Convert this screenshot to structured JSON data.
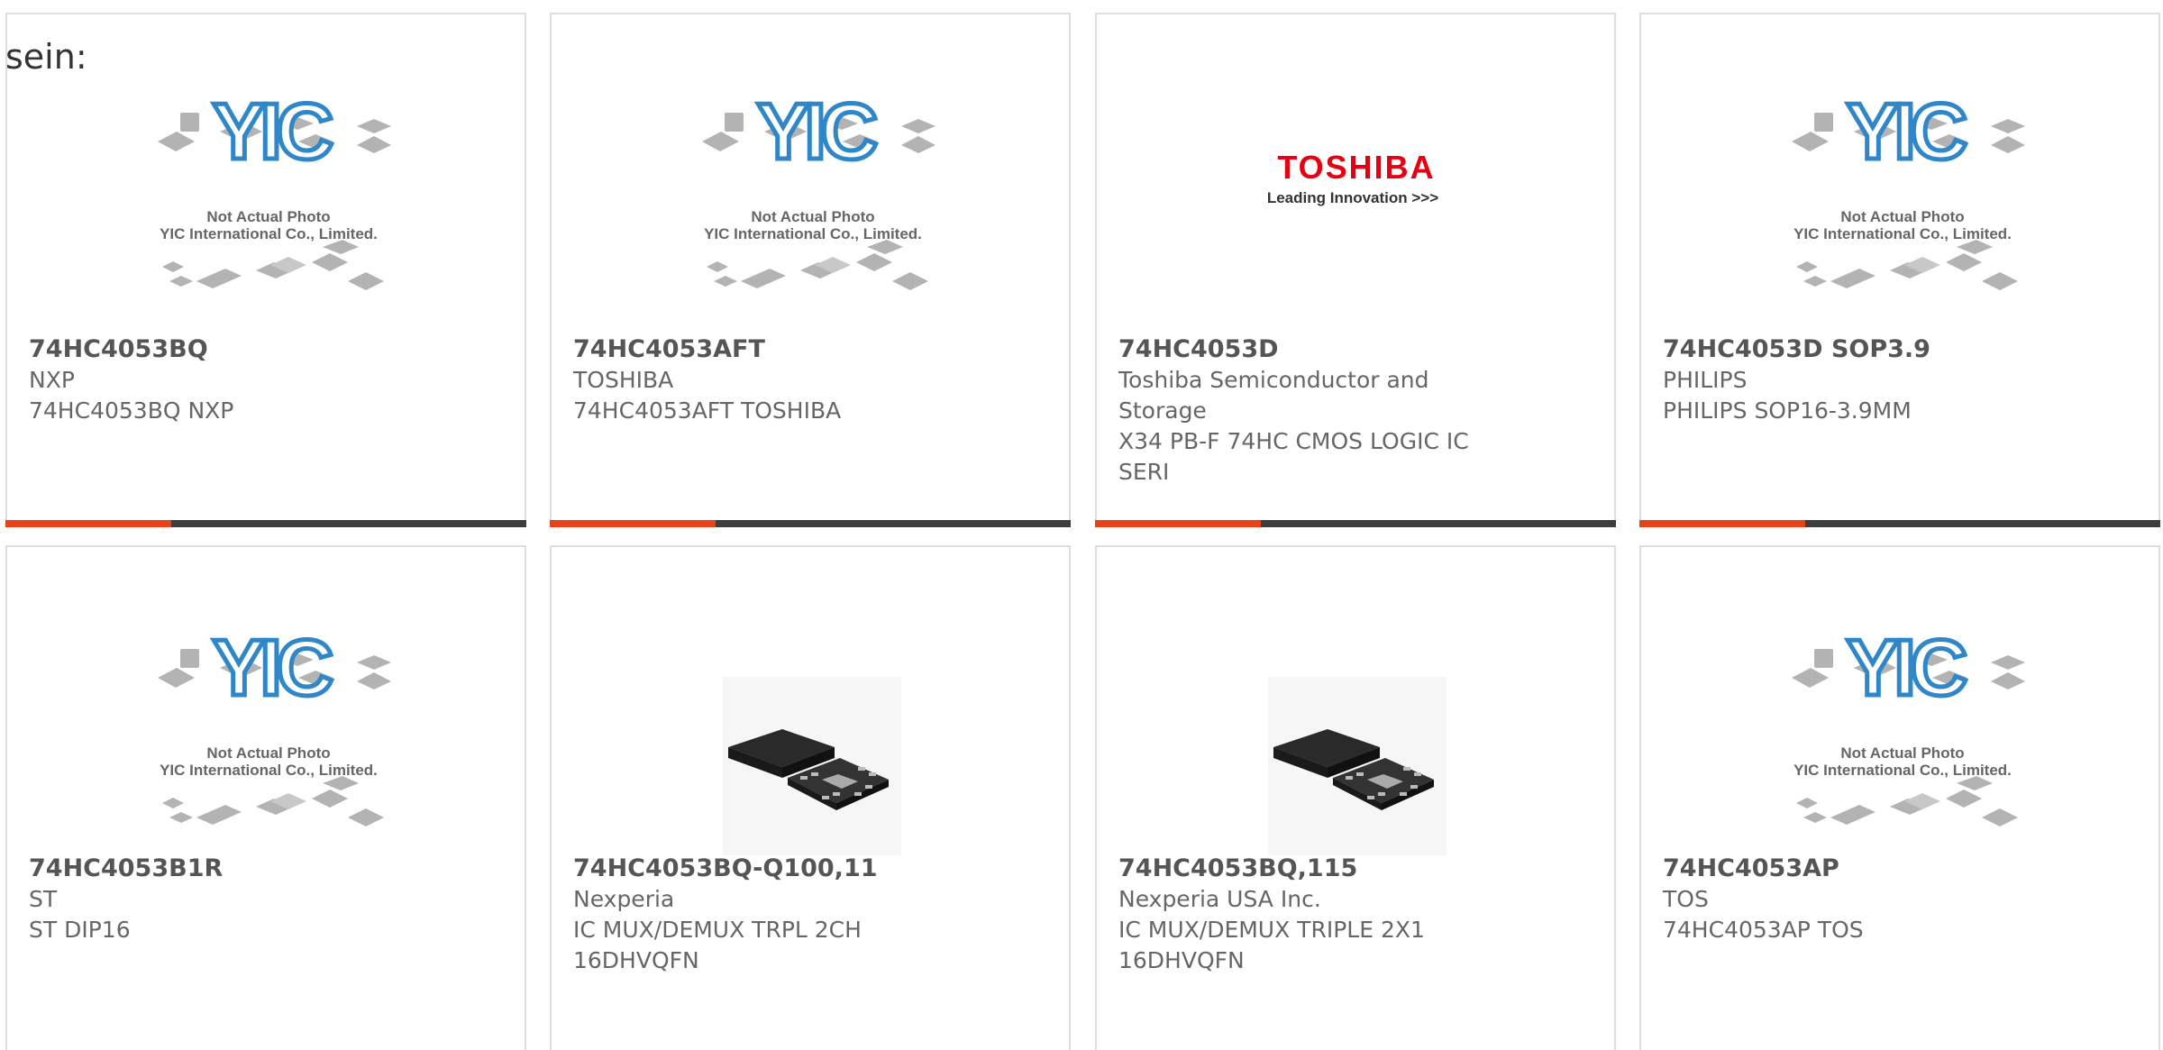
{
  "heading": "sein:",
  "placeholder_text": {
    "line1": "Not Actual Photo",
    "line2": "YIC International Co., Limited.",
    "logo": "YIC"
  },
  "toshiba_logo": {
    "brand": "TOSHIBA",
    "tagline": "Leading Innovation >>>"
  },
  "colors": {
    "accent": "#e8421a",
    "bar": "#3d3d3d",
    "border": "#dedede",
    "yic_blue": "#2f86c8",
    "toshiba_red": "#e60012"
  },
  "products": [
    {
      "part": "74HC4053BQ",
      "brand": "NXP",
      "desc": "74HC4053BQ NXP",
      "image": "yic-placeholder"
    },
    {
      "part": "74HC4053AFT",
      "brand": "TOSHIBA",
      "desc": "74HC4053AFT TOSHIBA",
      "image": "yic-placeholder"
    },
    {
      "part": "74HC4053D",
      "brand": "Toshiba Semiconductor and Storage",
      "desc": "X34 PB-F 74HC CMOS LOGIC IC SERI",
      "image": "toshiba-logo"
    },
    {
      "part": "74HC4053D SOP3.9",
      "brand": "PHILIPS",
      "desc": "PHILIPS SOP16-3.9MM",
      "image": "yic-placeholder"
    },
    {
      "part": "74HC4053B1R",
      "brand": "ST",
      "desc": "ST DIP16",
      "image": "yic-placeholder"
    },
    {
      "part": "74HC4053BQ-Q100,11",
      "brand": "Nexperia",
      "desc": "IC MUX/DEMUX TRPL 2CH 16DHVQFN",
      "image": "qfn-chip-photo"
    },
    {
      "part": "74HC4053BQ,115",
      "brand": "Nexperia USA Inc.",
      "desc": "IC MUX/DEMUX TRIPLE 2X1 16DHVQFN",
      "image": "qfn-chip-photo"
    },
    {
      "part": "74HC4053AP",
      "brand": "TOS",
      "desc": "74HC4053AP TOS",
      "image": "yic-placeholder"
    }
  ]
}
